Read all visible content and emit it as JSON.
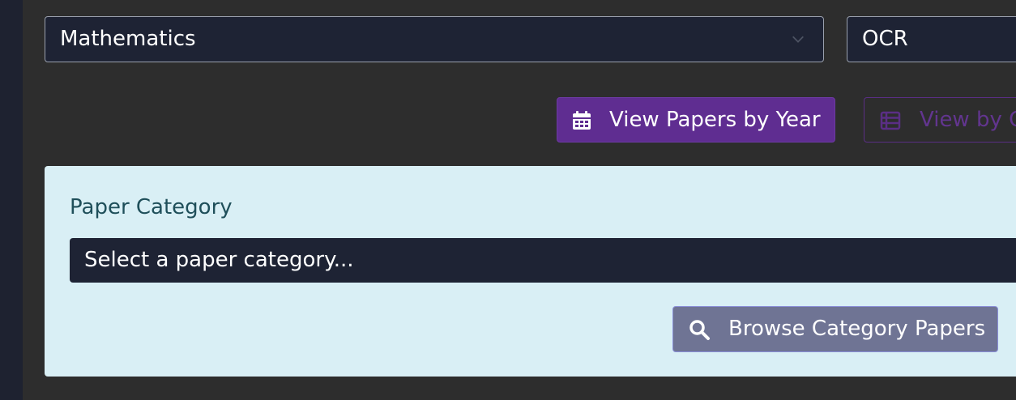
{
  "filters": {
    "subject": {
      "value": "Mathematics"
    },
    "board": {
      "value": "OCR"
    }
  },
  "view_toggle": {
    "by_year_label": "View Papers by Year",
    "by_other_label": "View by C"
  },
  "category_panel": {
    "label": "Paper Category",
    "select_placeholder": "Select a paper category...",
    "browse_button_label": "Browse Category Papers"
  },
  "icons": {
    "dropdown": "chevron-down-icon",
    "year_button": "calendar-icon",
    "other_button": "list-icon",
    "browse_button": "search-icon"
  },
  "colors": {
    "page_background": "#2d2d2d",
    "input_background": "#1e2334",
    "accent_purple": "#5f2d91",
    "panel_background": "#d9eff5",
    "browse_button": "#6f7494"
  }
}
